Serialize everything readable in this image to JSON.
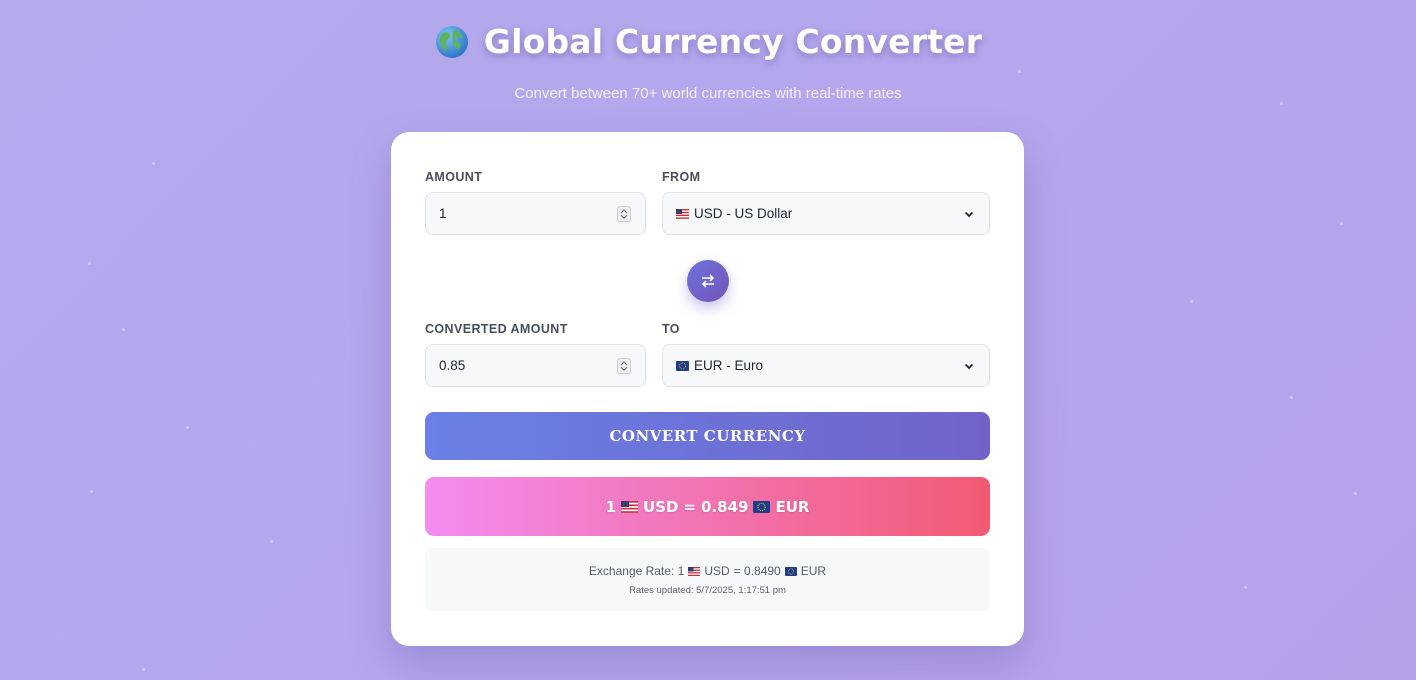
{
  "header": {
    "title": "Global Currency Converter",
    "subtitle": "Convert between 70+ world currencies with real-time rates",
    "icon": "globe-icon"
  },
  "form": {
    "amount_label": "AMOUNT",
    "amount_value": "1",
    "from_label": "FROM",
    "from_value": "USD - US Dollar",
    "from_flag": "us-flag-icon",
    "converted_label": "CONVERTED AMOUNT",
    "converted_value": "0.85",
    "to_label": "TO",
    "to_value": "EUR - Euro",
    "to_flag": "eu-flag-icon",
    "swap_icon": "swap-icon"
  },
  "convert_button": {
    "label": "CONVERT CURRENCY"
  },
  "result": {
    "amount": "1",
    "from_code": "USD",
    "equals": "=",
    "value": "0.849",
    "to_code": "EUR"
  },
  "info": {
    "rate_prefix": "Exchange Rate: 1",
    "rate_from": "USD",
    "rate_equals": "= 0.8490",
    "rate_to": "EUR",
    "updated": "Rates updated: 5/7/2025, 1:17:51 pm"
  },
  "colors": {
    "background": "#b5a6ee",
    "convert_button_start": "#6a80e6",
    "convert_button_end": "#7063c8",
    "result_start": "#f28cf0",
    "result_end": "#f25a72"
  }
}
